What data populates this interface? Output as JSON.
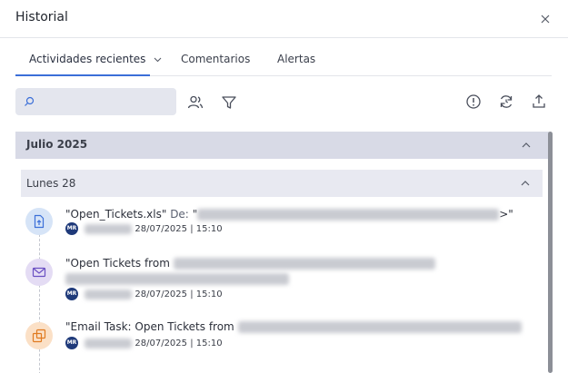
{
  "header": {
    "title": "Historial"
  },
  "tabs": [
    {
      "label": "Actividades recientes"
    },
    {
      "label": "Comentarios"
    },
    {
      "label": "Alertas"
    }
  ],
  "search": {
    "value": "",
    "placeholder": ""
  },
  "groups": {
    "month": "Julio 2025",
    "day": "Lunes 28"
  },
  "entries": [
    {
      "title": "\"Open_Tickets.xls\"",
      "from_label": "De:",
      "title_tail": "\"",
      "tail_mark": ">\"",
      "avatar": "MR",
      "datetime": "28/07/2025 | 15:10"
    },
    {
      "title": "\"Open Tickets from",
      "avatar": "MR",
      "datetime": "28/07/2025 | 15:10"
    },
    {
      "title": "\"Email Task: Open Tickets from",
      "avatar": "MR",
      "datetime": "28/07/2025 | 15:10"
    }
  ],
  "colors": {
    "accent": "#3b6fd8",
    "file_icon_bg": "#d6e4f7",
    "mail_icon_bg": "#e4dcf4",
    "task_icon_bg": "#fbe0c6"
  },
  "icons": {
    "close": "close-icon",
    "search": "search-icon",
    "users": "users-icon",
    "filter": "filter-icon",
    "info": "alert-circle-icon",
    "refresh": "refresh-icon",
    "export": "export-icon",
    "file": "file-upload-icon",
    "mail": "mail-icon",
    "task": "task-copy-icon"
  }
}
